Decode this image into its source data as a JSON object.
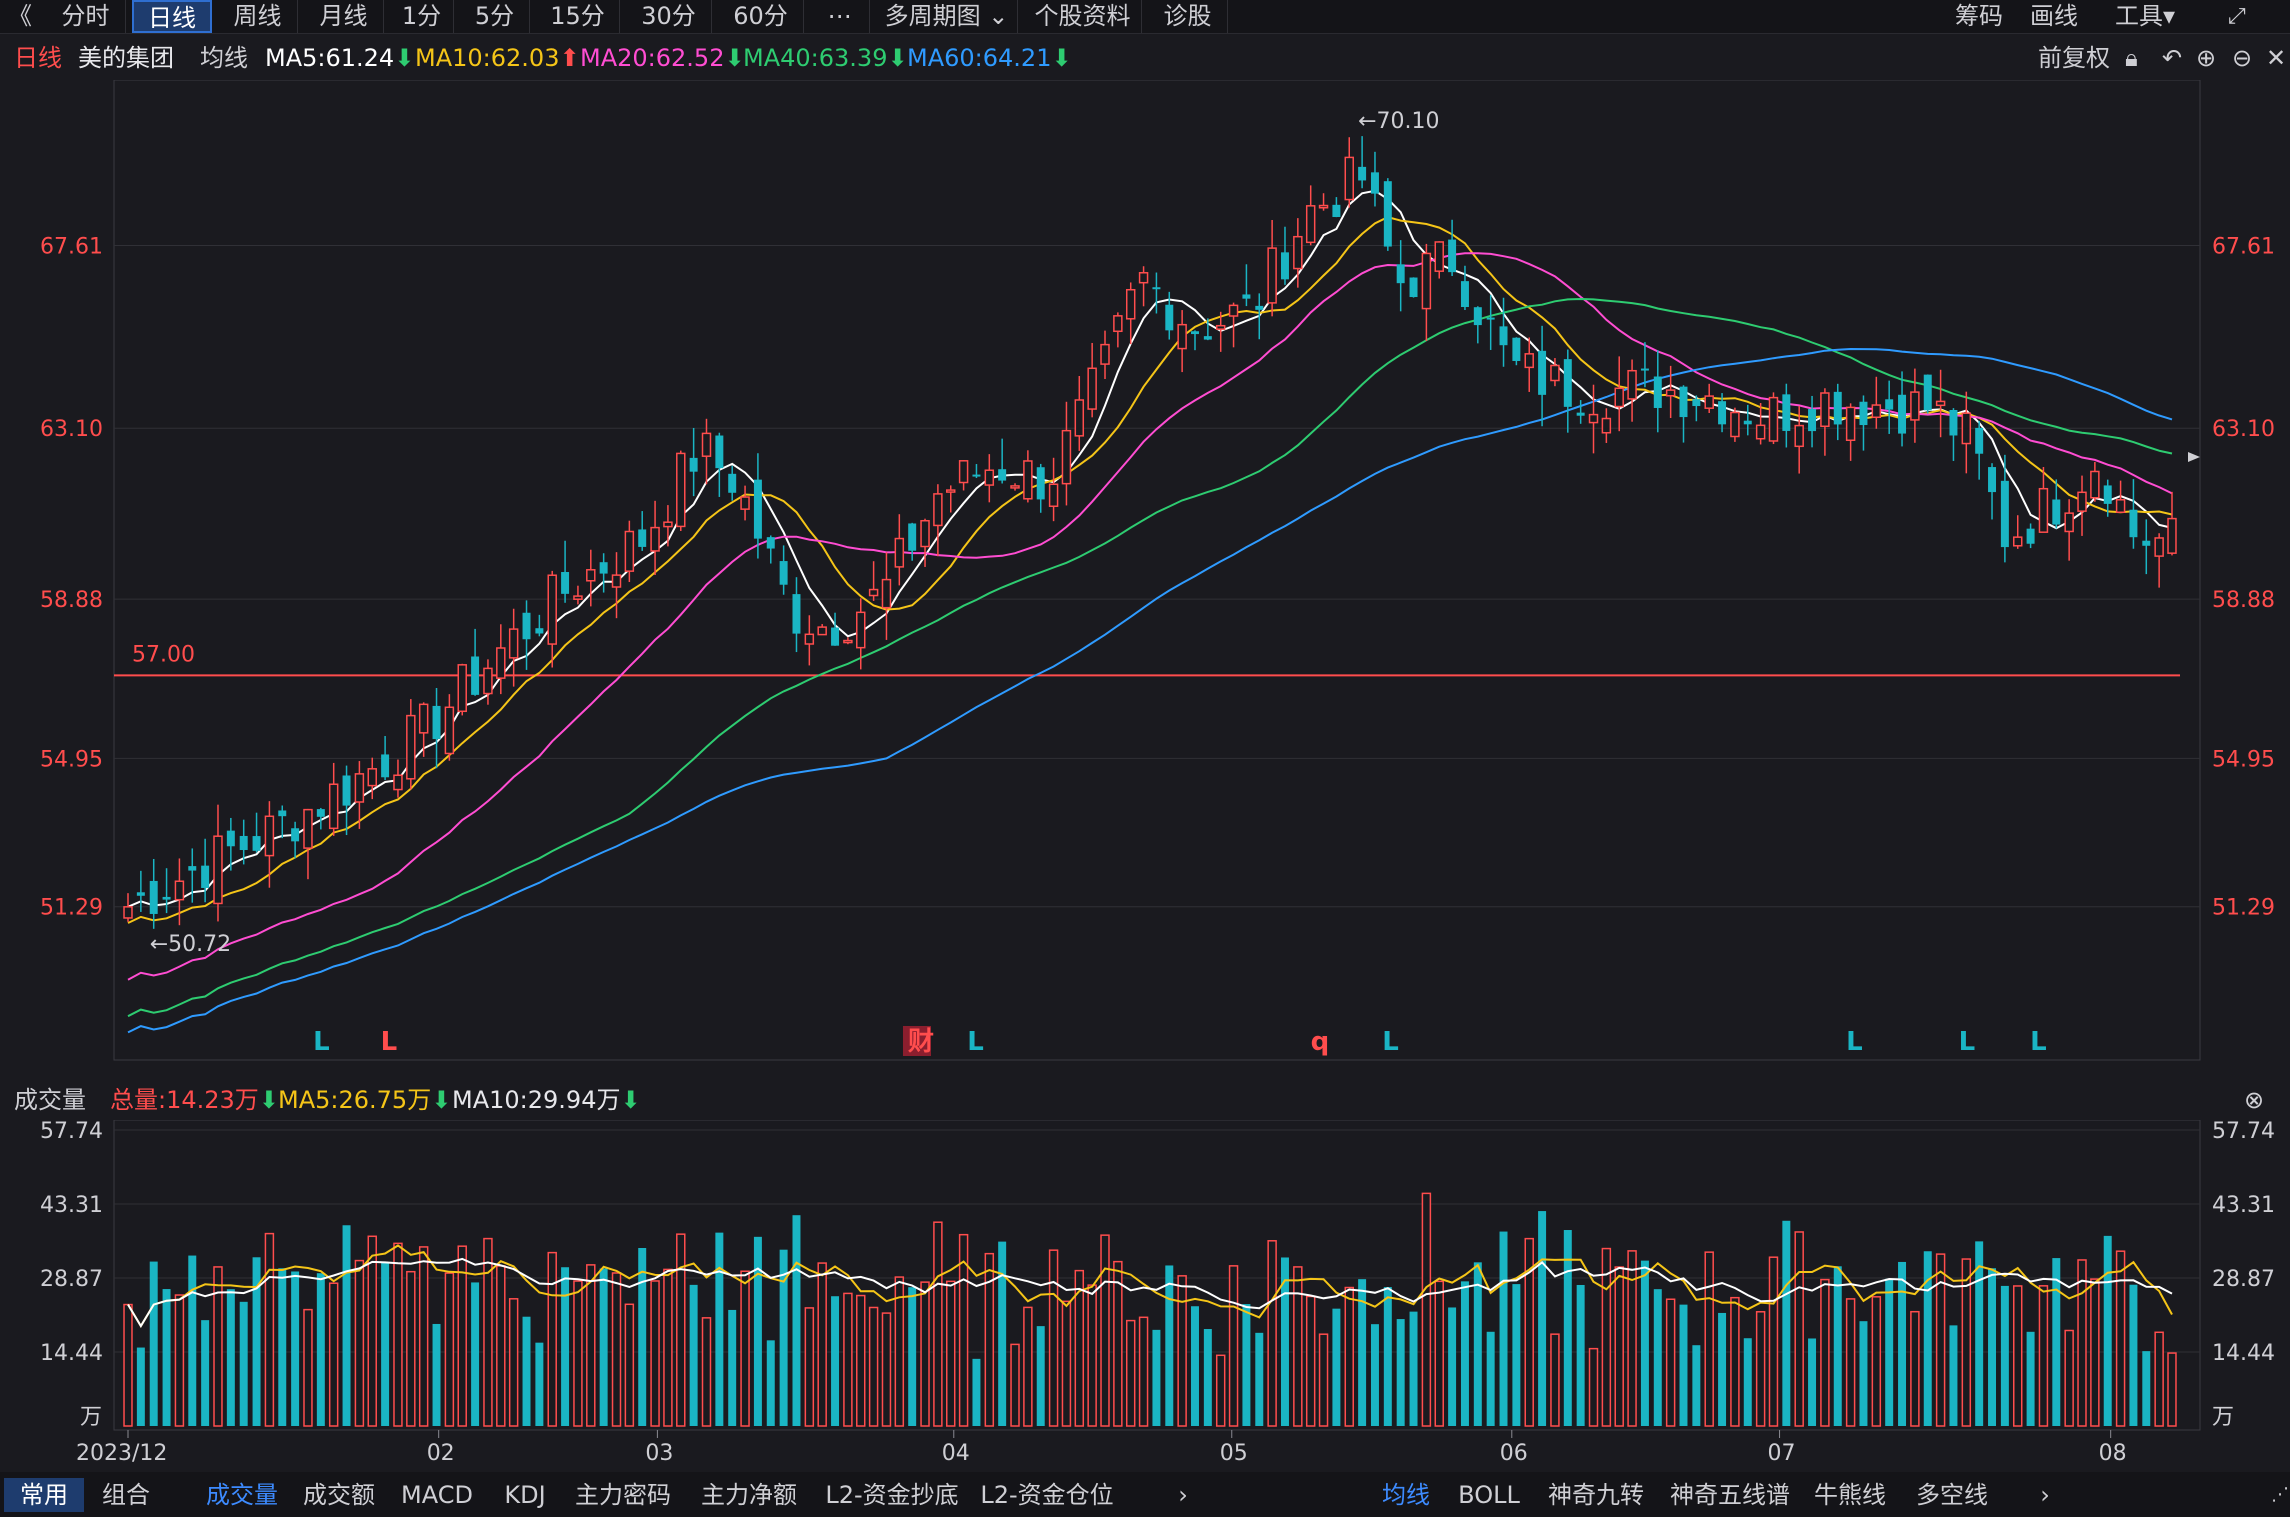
{
  "toolbar": {
    "back": "《",
    "periods": [
      "分时",
      "日线",
      "周线",
      "月线",
      "1分",
      "5分",
      "15分",
      "30分",
      "60分",
      "⋯",
      "多周期图 ⌄",
      "个股资料",
      "诊股"
    ],
    "active_index": 1,
    "right": [
      "筹码",
      "画线",
      "工具▾"
    ]
  },
  "info": {
    "period": "日线",
    "name": "美的集团",
    "ma_label": "均线",
    "ma5": "MA5:61.24",
    "ma10": "MA10:62.03",
    "ma20": "MA20:62.52",
    "ma40": "MA40:63.39",
    "ma60": "MA60:64.21",
    "fq": "前复权"
  },
  "colors": {
    "up": "#ff4d4d",
    "down": "#1ab5c4",
    "ma5": "#ffffff",
    "ma10": "#f5c518",
    "ma20": "#ff4dd2",
    "ma40": "#2ecc71",
    "ma60": "#2f9bff"
  },
  "price_axis": [
    "67.61",
    "63.10",
    "58.88",
    "54.95",
    "51.29"
  ],
  "annotations": {
    "high": "←70.10",
    "low": "←50.72",
    "hline_label": "57.00"
  },
  "markers": [
    {
      "text": "L",
      "color": "down"
    },
    {
      "text": "L",
      "color": "up"
    },
    {
      "text": "财",
      "color": "up"
    },
    {
      "text": "L",
      "color": "down"
    },
    {
      "text": "q",
      "color": "up"
    },
    {
      "text": "L",
      "color": "down"
    },
    {
      "text": "L",
      "color": "down"
    },
    {
      "text": "L",
      "color": "down"
    },
    {
      "text": "L",
      "color": "down"
    }
  ],
  "volume_info": {
    "label": "成交量",
    "total": "总量:14.23万",
    "ma5": "MA5:26.75万",
    "ma10": "MA10:29.94万"
  },
  "volume_axis": [
    "57.74",
    "43.31",
    "28.87",
    "14.44",
    "万"
  ],
  "x_axis": [
    "2023/12",
    "02",
    "03",
    "04",
    "05",
    "06",
    "07",
    "08"
  ],
  "bottom": {
    "left": [
      "常用",
      "组合"
    ],
    "indicators": [
      "成交量",
      "成交额",
      "MACD",
      "KDJ",
      "主力密码",
      "主力净额",
      "L2-资金抄底",
      "L2-资金仓位"
    ],
    "right": [
      "均线",
      "BOLL",
      "神奇九转",
      "神奇五线谱",
      "牛熊线",
      "多空线"
    ]
  },
  "chart_data": {
    "type": "candlestick",
    "count": 160,
    "ylim": [
      48.0,
      71.2
    ],
    "hline": 57.0,
    "anchors": [
      [
        0,
        51.3
      ],
      [
        8,
        52.3
      ],
      [
        16,
        53.2
      ],
      [
        24,
        54.3
      ],
      [
        32,
        55.6
      ],
      [
        40,
        57.5
      ],
      [
        48,
        59.2
      ],
      [
        56,
        60.4
      ],
      [
        62,
        62.6
      ],
      [
        66,
        61.8
      ],
      [
        72,
        58.6
      ],
      [
        76,
        58.2
      ],
      [
        82,
        59.0
      ],
      [
        88,
        61.5
      ],
      [
        94,
        62.2
      ],
      [
        100,
        61.8
      ],
      [
        106,
        64.5
      ],
      [
        110,
        66.8
      ],
      [
        116,
        65.6
      ],
      [
        122,
        66.0
      ],
      [
        128,
        68.4
      ],
      [
        134,
        69.3
      ],
      [
        138,
        66.7
      ],
      [
        144,
        67.3
      ],
      [
        150,
        64.6
      ],
      [
        156,
        64.1
      ],
      [
        160,
        64.0
      ],
      [
        166,
        64.1
      ],
      [
        172,
        63.9
      ],
      [
        178,
        63.4
      ],
      [
        184,
        63.8
      ],
      [
        190,
        63.7
      ],
      [
        196,
        63.6
      ],
      [
        200,
        62.8
      ],
      [
        204,
        60.4
      ],
      [
        210,
        61.4
      ],
      [
        214,
        62.4
      ],
      [
        218,
        60.4
      ],
      [
        222,
        60.3
      ]
    ],
    "volume_ylim": [
      0,
      57.74
    ]
  }
}
